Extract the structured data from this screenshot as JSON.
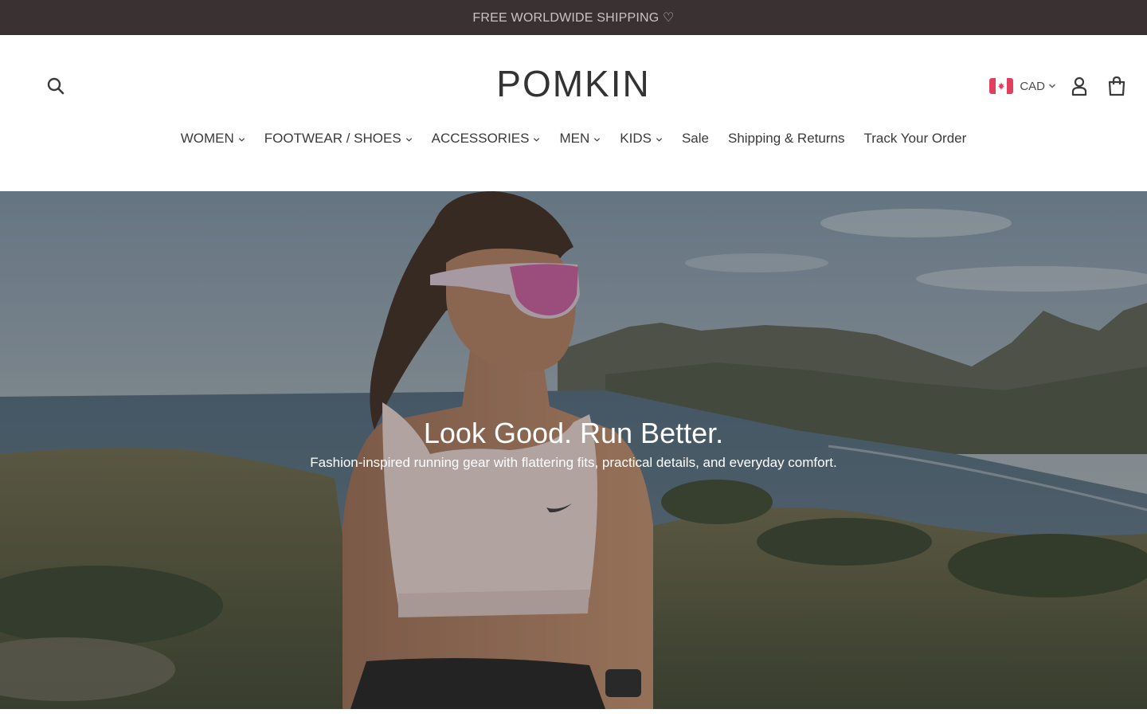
{
  "announcement": {
    "text": "FREE WORLDWIDE SHIPPING ♡"
  },
  "header": {
    "logo": "POMKIN",
    "search_icon": "search-icon",
    "currency": {
      "code": "CAD",
      "flag_icon": "canada-flag-icon"
    },
    "account_icon": "user-icon",
    "cart_icon": "shopping-bag-icon"
  },
  "nav": {
    "items": [
      {
        "label": "WOMEN",
        "has_dropdown": true
      },
      {
        "label": "FOOTWEAR / SHOES",
        "has_dropdown": true
      },
      {
        "label": "ACCESSORIES",
        "has_dropdown": true
      },
      {
        "label": "MEN",
        "has_dropdown": true
      },
      {
        "label": "KIDS",
        "has_dropdown": true
      },
      {
        "label": "Sale",
        "has_dropdown": false
      },
      {
        "label": "Shipping & Returns",
        "has_dropdown": false
      },
      {
        "label": "Track Your Order",
        "has_dropdown": false
      }
    ]
  },
  "hero": {
    "title": "Look Good. Run Better.",
    "subtitle": "Fashion-inspired running gear with flattering fits, practical details, and everyday comfort."
  },
  "colors": {
    "announcement_bg": "#3a3132",
    "text": "#3a3a3a",
    "flag_red": "#e0405e"
  }
}
